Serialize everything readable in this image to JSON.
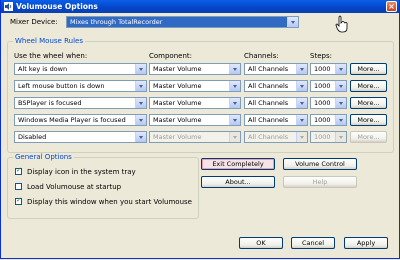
{
  "window": {
    "title": "Volumouse Options",
    "close_glyph": "×",
    "icon": "speaker-icon"
  },
  "mixer": {
    "label": "Mixer Device:",
    "value": "Mixes through TotalRecorder"
  },
  "rules": {
    "group_title": "Wheel Mouse Rules",
    "headers": {
      "use_when": "Use the wheel when:",
      "component": "Component:",
      "channels": "Channels:",
      "steps": "Steps:"
    },
    "rows": [
      {
        "when": "Alt key is down",
        "component": "Master Volume",
        "channels": "All Channels",
        "steps": "1000",
        "more": "More...",
        "enabled": true
      },
      {
        "when": "Left mouse button is down",
        "component": "Master Volume",
        "channels": "All Channels",
        "steps": "1000",
        "more": "More...",
        "enabled": true
      },
      {
        "when": "BSPlayer is focused",
        "component": "Master Volume",
        "channels": "All Channels",
        "steps": "1000",
        "more": "More...",
        "enabled": true
      },
      {
        "when": "Windows Media Player is focused",
        "component": "Master Volume",
        "channels": "All Channels",
        "steps": "1000",
        "more": "More...",
        "enabled": true
      },
      {
        "when": "Disabled",
        "component": "Master Volume",
        "channels": "All Channels",
        "steps": "1000",
        "more": "More...",
        "enabled": false
      }
    ]
  },
  "general": {
    "group_title": "General Options",
    "options": [
      {
        "label": "Display icon in the system tray",
        "checked": true
      },
      {
        "label": "Load Volumouse at startup",
        "checked": false
      },
      {
        "label": "Display this window when you start Volumouse",
        "checked": true
      }
    ]
  },
  "actions": {
    "exit": "Exit Completely",
    "volume_control": "Volume Control",
    "about": "About...",
    "help": "Help"
  },
  "footer": {
    "ok": "OK",
    "cancel": "Cancel",
    "apply": "Apply"
  },
  "icons": {
    "checkmark": "✓"
  },
  "colors": {
    "titlebar": "#0645c8",
    "selection": "#316ac5",
    "group_title": "#0046d5"
  }
}
